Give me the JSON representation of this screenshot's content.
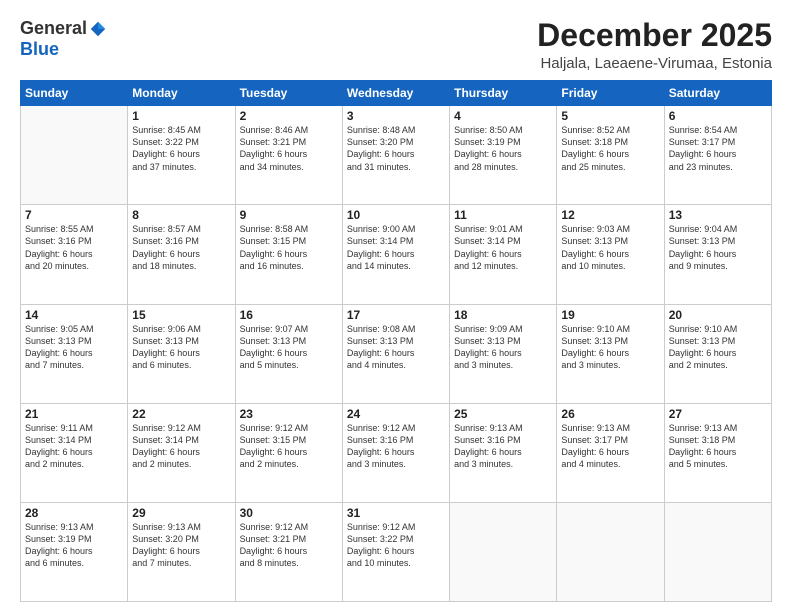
{
  "logo": {
    "general": "General",
    "blue": "Blue"
  },
  "title": "December 2025",
  "subtitle": "Haljala, Laeaene-Virumaa, Estonia",
  "days": [
    "Sunday",
    "Monday",
    "Tuesday",
    "Wednesday",
    "Thursday",
    "Friday",
    "Saturday"
  ],
  "weeks": [
    [
      {
        "day": "",
        "info": ""
      },
      {
        "day": "1",
        "info": "Sunrise: 8:45 AM\nSunset: 3:22 PM\nDaylight: 6 hours\nand 37 minutes."
      },
      {
        "day": "2",
        "info": "Sunrise: 8:46 AM\nSunset: 3:21 PM\nDaylight: 6 hours\nand 34 minutes."
      },
      {
        "day": "3",
        "info": "Sunrise: 8:48 AM\nSunset: 3:20 PM\nDaylight: 6 hours\nand 31 minutes."
      },
      {
        "day": "4",
        "info": "Sunrise: 8:50 AM\nSunset: 3:19 PM\nDaylight: 6 hours\nand 28 minutes."
      },
      {
        "day": "5",
        "info": "Sunrise: 8:52 AM\nSunset: 3:18 PM\nDaylight: 6 hours\nand 25 minutes."
      },
      {
        "day": "6",
        "info": "Sunrise: 8:54 AM\nSunset: 3:17 PM\nDaylight: 6 hours\nand 23 minutes."
      }
    ],
    [
      {
        "day": "7",
        "info": "Sunrise: 8:55 AM\nSunset: 3:16 PM\nDaylight: 6 hours\nand 20 minutes."
      },
      {
        "day": "8",
        "info": "Sunrise: 8:57 AM\nSunset: 3:16 PM\nDaylight: 6 hours\nand 18 minutes."
      },
      {
        "day": "9",
        "info": "Sunrise: 8:58 AM\nSunset: 3:15 PM\nDaylight: 6 hours\nand 16 minutes."
      },
      {
        "day": "10",
        "info": "Sunrise: 9:00 AM\nSunset: 3:14 PM\nDaylight: 6 hours\nand 14 minutes."
      },
      {
        "day": "11",
        "info": "Sunrise: 9:01 AM\nSunset: 3:14 PM\nDaylight: 6 hours\nand 12 minutes."
      },
      {
        "day": "12",
        "info": "Sunrise: 9:03 AM\nSunset: 3:13 PM\nDaylight: 6 hours\nand 10 minutes."
      },
      {
        "day": "13",
        "info": "Sunrise: 9:04 AM\nSunset: 3:13 PM\nDaylight: 6 hours\nand 9 minutes."
      }
    ],
    [
      {
        "day": "14",
        "info": "Sunrise: 9:05 AM\nSunset: 3:13 PM\nDaylight: 6 hours\nand 7 minutes."
      },
      {
        "day": "15",
        "info": "Sunrise: 9:06 AM\nSunset: 3:13 PM\nDaylight: 6 hours\nand 6 minutes."
      },
      {
        "day": "16",
        "info": "Sunrise: 9:07 AM\nSunset: 3:13 PM\nDaylight: 6 hours\nand 5 minutes."
      },
      {
        "day": "17",
        "info": "Sunrise: 9:08 AM\nSunset: 3:13 PM\nDaylight: 6 hours\nand 4 minutes."
      },
      {
        "day": "18",
        "info": "Sunrise: 9:09 AM\nSunset: 3:13 PM\nDaylight: 6 hours\nand 3 minutes."
      },
      {
        "day": "19",
        "info": "Sunrise: 9:10 AM\nSunset: 3:13 PM\nDaylight: 6 hours\nand 3 minutes."
      },
      {
        "day": "20",
        "info": "Sunrise: 9:10 AM\nSunset: 3:13 PM\nDaylight: 6 hours\nand 2 minutes."
      }
    ],
    [
      {
        "day": "21",
        "info": "Sunrise: 9:11 AM\nSunset: 3:14 PM\nDaylight: 6 hours\nand 2 minutes."
      },
      {
        "day": "22",
        "info": "Sunrise: 9:12 AM\nSunset: 3:14 PM\nDaylight: 6 hours\nand 2 minutes."
      },
      {
        "day": "23",
        "info": "Sunrise: 9:12 AM\nSunset: 3:15 PM\nDaylight: 6 hours\nand 2 minutes."
      },
      {
        "day": "24",
        "info": "Sunrise: 9:12 AM\nSunset: 3:16 PM\nDaylight: 6 hours\nand 3 minutes."
      },
      {
        "day": "25",
        "info": "Sunrise: 9:13 AM\nSunset: 3:16 PM\nDaylight: 6 hours\nand 3 minutes."
      },
      {
        "day": "26",
        "info": "Sunrise: 9:13 AM\nSunset: 3:17 PM\nDaylight: 6 hours\nand 4 minutes."
      },
      {
        "day": "27",
        "info": "Sunrise: 9:13 AM\nSunset: 3:18 PM\nDaylight: 6 hours\nand 5 minutes."
      }
    ],
    [
      {
        "day": "28",
        "info": "Sunrise: 9:13 AM\nSunset: 3:19 PM\nDaylight: 6 hours\nand 6 minutes."
      },
      {
        "day": "29",
        "info": "Sunrise: 9:13 AM\nSunset: 3:20 PM\nDaylight: 6 hours\nand 7 minutes."
      },
      {
        "day": "30",
        "info": "Sunrise: 9:12 AM\nSunset: 3:21 PM\nDaylight: 6 hours\nand 8 minutes."
      },
      {
        "day": "31",
        "info": "Sunrise: 9:12 AM\nSunset: 3:22 PM\nDaylight: 6 hours\nand 10 minutes."
      },
      {
        "day": "",
        "info": ""
      },
      {
        "day": "",
        "info": ""
      },
      {
        "day": "",
        "info": ""
      }
    ]
  ]
}
